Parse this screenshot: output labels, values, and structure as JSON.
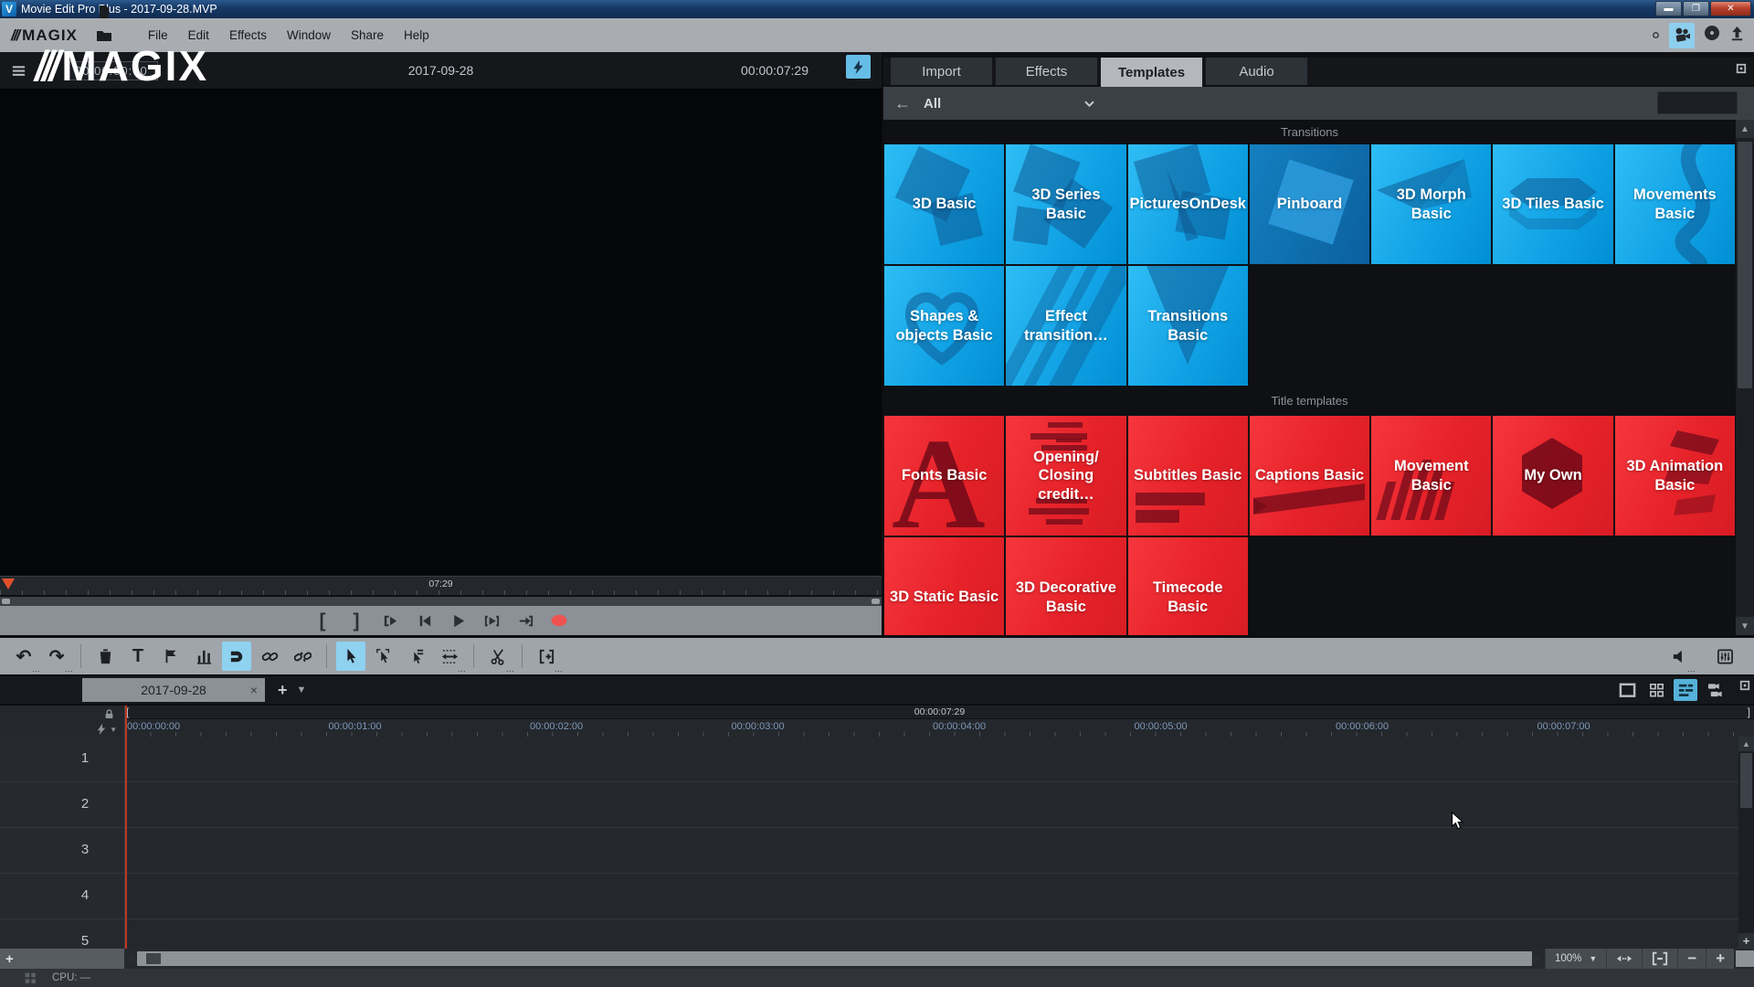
{
  "titlebar": {
    "title": "Movie Edit Pro Plus - 2017-09-28.MVP",
    "app_initial": "V"
  },
  "menubar": {
    "brand": "MAGIX",
    "menus": [
      "File",
      "Edit",
      "Effects",
      "Window",
      "Share",
      "Help"
    ],
    "file_icons": [
      "new-document",
      "open-folder",
      "save"
    ],
    "right_icons": [
      "record-state",
      "video-camera",
      "burn-disc",
      "export-upload"
    ]
  },
  "preview": {
    "timecode": "00:00:00:00",
    "watermark": "MAGIX",
    "project_title": "2017-09-28",
    "duration": "00:00:07:29",
    "scrub_time": "07:29"
  },
  "media_pool": {
    "tabs": [
      "Import",
      "Effects",
      "Templates",
      "Audio"
    ],
    "active_tab": "Templates",
    "filter_label": "All",
    "search_value": "",
    "sections": [
      {
        "title": "Transitions",
        "color": "blue",
        "tiles": [
          {
            "label": "3D Basic",
            "shape": "rot-squares"
          },
          {
            "label": "3D Series Basic",
            "shape": "rot-squares-2"
          },
          {
            "label": "PicturesOnDesk",
            "shape": "photos"
          },
          {
            "label": "Pinboard",
            "shape": "pin-square",
            "variant": "dark"
          },
          {
            "label": "3D Morph Basic",
            "shape": "paper-plane"
          },
          {
            "label": "3D Tiles Basic",
            "shape": "hex-band"
          },
          {
            "label": "Movements Basic",
            "shape": "wave"
          },
          {
            "label": "Shapes & objects Basic",
            "shape": "heart"
          },
          {
            "label": "Effect transition…",
            "shape": "diagonal-stripes"
          },
          {
            "label": "Transitions Basic",
            "shape": "v-wipe"
          }
        ]
      },
      {
        "title": "Title templates",
        "color": "red",
        "tiles": [
          {
            "label": "Fonts Basic",
            "shape": "letter-a"
          },
          {
            "label": "Opening/\nClosing credit…",
            "shape": "credit-lines"
          },
          {
            "label": "Subtitles Basic",
            "shape": "subtitle-bars"
          },
          {
            "label": "Captions Basic",
            "shape": "caption-ribbon"
          },
          {
            "label": "Movement Basic",
            "shape": "slats"
          },
          {
            "label": "My Own",
            "shape": "hexagon"
          },
          {
            "label": "3D Animation Basic",
            "shape": "fold-ribbon"
          },
          {
            "label": "3D Static Basic",
            "shape": "plain"
          },
          {
            "label": "3D Decorative Basic",
            "shape": "plain"
          },
          {
            "label": "Timecode Basic",
            "shape": "plain"
          }
        ]
      }
    ]
  },
  "transport": {
    "buttons": [
      {
        "name": "range-start",
        "icon": "bracket-left"
      },
      {
        "name": "range-end",
        "icon": "bracket-right"
      },
      {
        "name": "jump-to-start",
        "icon": "to-start"
      },
      {
        "name": "previous-frame",
        "icon": "prev-frame"
      },
      {
        "name": "play",
        "icon": "play"
      },
      {
        "name": "play-range",
        "icon": "play-range"
      },
      {
        "name": "jump-to-end",
        "icon": "to-end"
      },
      {
        "name": "record",
        "icon": "record"
      }
    ]
  },
  "toolbar": {
    "groups": [
      [
        {
          "name": "undo",
          "icon": "undo",
          "dots": true
        },
        {
          "name": "redo",
          "icon": "redo",
          "dots": true
        }
      ],
      [
        {
          "name": "delete",
          "icon": "trash"
        },
        {
          "name": "title-editor",
          "icon": "text-t"
        },
        {
          "name": "set-marker",
          "icon": "flag"
        },
        {
          "name": "audio-levels",
          "icon": "levels"
        },
        {
          "name": "snap",
          "icon": "magnet",
          "active": true
        },
        {
          "name": "group",
          "icon": "link"
        },
        {
          "name": "ungroup",
          "icon": "link-broken"
        }
      ],
      [
        {
          "name": "mouse-mode-single",
          "icon": "pointer",
          "active": true
        },
        {
          "name": "mouse-mode-object",
          "icon": "pointer-object"
        },
        {
          "name": "mouse-mode-all-tracks",
          "icon": "pointer-tracks"
        },
        {
          "name": "mouse-mode-stretch",
          "icon": "stretch",
          "dots": true
        }
      ],
      [
        {
          "name": "split",
          "icon": "scissors",
          "dots": true
        }
      ],
      [
        {
          "name": "insert-mode",
          "icon": "insert-range",
          "dots": true
        }
      ]
    ],
    "right": [
      {
        "name": "audio-output",
        "icon": "speaker",
        "dots": true
      },
      {
        "name": "mixer",
        "icon": "mixer"
      }
    ]
  },
  "timeline": {
    "tab_label": "2017-09-28",
    "range_label": "00:00:07:29",
    "range_start_bracket": "[",
    "range_end_bracket": "]",
    "ruler_labels": [
      "00:00:00:00",
      "00:00:01:00",
      "00:00:02:00",
      "00:00:03:00",
      "00:00:04:00",
      "00:00:05:00",
      "00:00:06:00",
      "00:00:07:00"
    ],
    "tracks": [
      "1",
      "2",
      "3",
      "4",
      "5"
    ],
    "view_buttons": [
      {
        "name": "scene-overview-mode",
        "icon": "monitor-view"
      },
      {
        "name": "storyboard-mode",
        "icon": "storyboard-view"
      },
      {
        "name": "timeline-mode",
        "icon": "timeline-view",
        "active": true
      },
      {
        "name": "multicam-mode",
        "icon": "multicam-view"
      }
    ],
    "zoom_level": "100%"
  },
  "statusbar": {
    "cpu_label": "CPU: —"
  },
  "colors": {
    "tile_blue": "#12a3e6",
    "tile_red": "#e62229",
    "highlight_blue": "#8ed2f0",
    "playhead_red": "#c0361f"
  }
}
